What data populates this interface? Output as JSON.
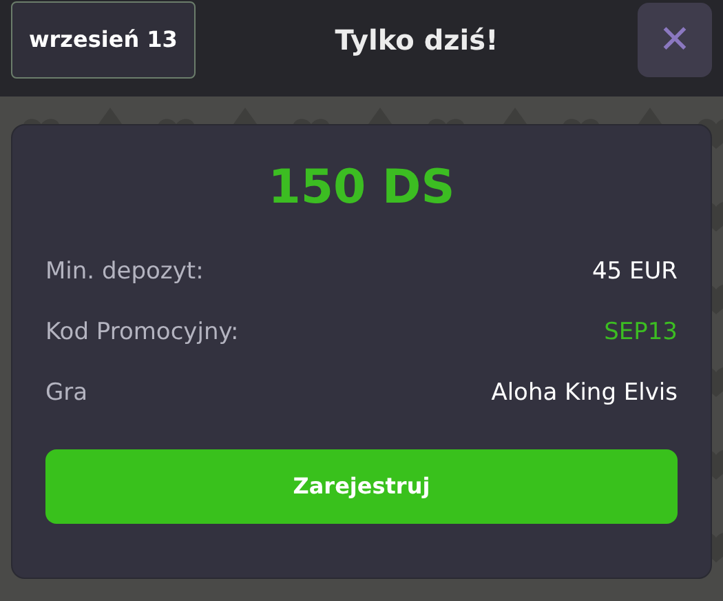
{
  "header": {
    "date_button": "wrzesień 13",
    "title": "Tylko dziś!",
    "close_button": "✕"
  },
  "offer": {
    "amount": "150 DS",
    "rows": [
      {
        "label": "Min. depozyt:",
        "value": "45 EUR",
        "highlight": false
      },
      {
        "label": "Kod Promocyjny:",
        "value": "SEP13",
        "highlight": true
      },
      {
        "label": "Gra",
        "value": "Aloha King Elvis",
        "highlight": false
      }
    ],
    "button": "Zarejestruj"
  }
}
